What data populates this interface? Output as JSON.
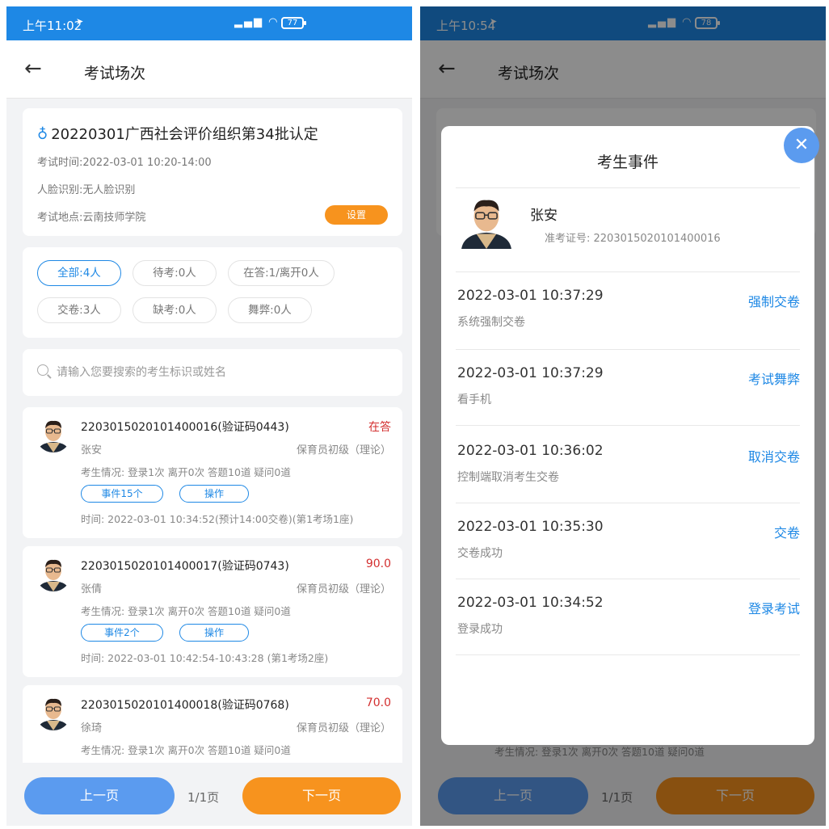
{
  "left": {
    "status": {
      "time": "上午11:02",
      "signal": "HD",
      "battery": "77"
    },
    "appbar": {
      "title": "考试场次"
    },
    "exam": {
      "name": "20220301广西社会评价组织第34批认定",
      "time": "考试时间:2022-03-01 10:20-14:00",
      "face": "人脸识别:无人脸识别",
      "location": "考试地点:云南技师学院",
      "settings_label": "设置"
    },
    "filters": [
      "全部:4人",
      "待考:0人",
      "在答:1/离开0人",
      "交卷:3人",
      "缺考:0人",
      "舞弊:0人"
    ],
    "search": {
      "placeholder": "请输入您要搜索的考生标识或姓名"
    },
    "students": [
      {
        "id": "2203015020101400016(验证码0443)",
        "status": "在答",
        "name": "张安",
        "level": "保育员初级（理论）",
        "stats": "考生情况: 登录1次  离开0次  答题10道  疑问0道",
        "events": "事件15个",
        "action": "操作",
        "time": "时间: 2022-03-01 10:34:52(预计14:00交卷)(第1考场1座)"
      },
      {
        "id": "2203015020101400017(验证码0743)",
        "status": "90.0",
        "name": "张倩",
        "level": "保育员初级（理论）",
        "stats": "考生情况: 登录1次  离开0次  答题10道  疑问0道",
        "events": "事件2个",
        "action": "操作",
        "time": "时间: 2022-03-01 10:42:54-10:43:28 (第1考场2座)"
      },
      {
        "id": "2203015020101400018(验证码0768)",
        "status": "70.0",
        "name": "徐琦",
        "level": "保育员初级（理论）",
        "stats": "考生情况: 登录1次  离开0次  答题10道  疑问0道",
        "events": "",
        "action": "",
        "time": ""
      }
    ],
    "pager": {
      "prev": "上一页",
      "page": "1/1页",
      "next": "下一页"
    }
  },
  "right": {
    "status": {
      "time": "上午10:54",
      "signal": "HD",
      "battery": "78"
    },
    "appbar": {
      "title": "考试场次"
    },
    "dialog": {
      "title": "考生事件",
      "name": "张安",
      "cert": "准考证号: 2203015020101400016",
      "events": [
        {
          "time": "2022-03-01 10:37:29",
          "desc": "系统强制交卷",
          "tag": "强制交卷"
        },
        {
          "time": "2022-03-01 10:37:29",
          "desc": "看手机",
          "tag": "考试舞弊"
        },
        {
          "time": "2022-03-01 10:36:02",
          "desc": "控制端取消考生交卷",
          "tag": "取消交卷"
        },
        {
          "time": "2022-03-01 10:35:30",
          "desc": "交卷成功",
          "tag": "交卷"
        },
        {
          "time": "2022-03-01 10:34:52",
          "desc": "登录成功",
          "tag": "登录考试"
        }
      ]
    },
    "background_stats": "考生情况: 登录1次  离开0次  答题10道  疑问0道",
    "pager": {
      "prev": "上一页",
      "page": "1/1页",
      "next": "下一页"
    }
  },
  "colors": {
    "primary": "#1e88e5",
    "accent": "#f7931e",
    "danger": "#d32f2f",
    "prev_button": "#5b9bef"
  }
}
